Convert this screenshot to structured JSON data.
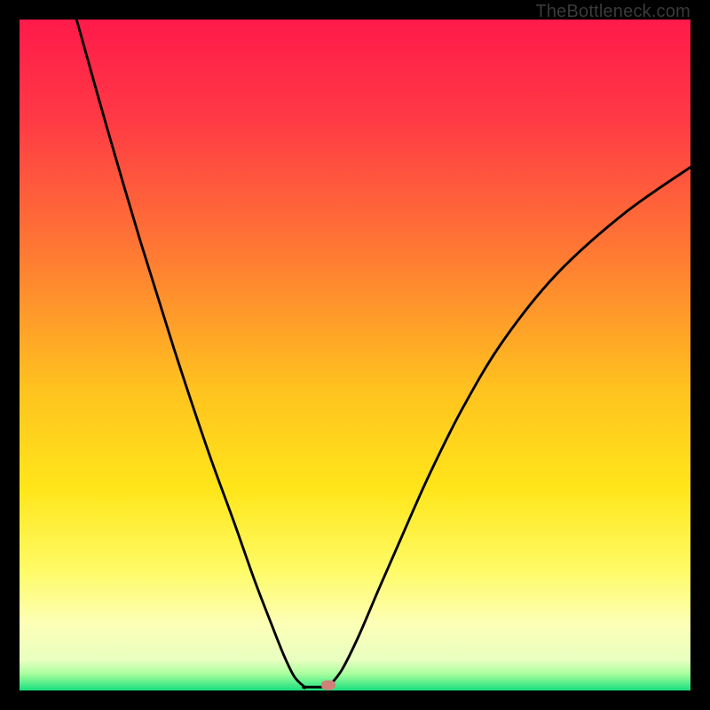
{
  "watermark": "TheBottleneck.com",
  "chart_data": {
    "type": "line",
    "title": "",
    "xlabel": "",
    "ylabel": "",
    "xlim": [
      0,
      100
    ],
    "ylim": [
      0,
      100
    ],
    "grid": false,
    "legend": false,
    "gradient_stops": [
      {
        "offset": 0.0,
        "color": "#ff1a4a"
      },
      {
        "offset": 0.15,
        "color": "#ff3a45"
      },
      {
        "offset": 0.35,
        "color": "#ff7a33"
      },
      {
        "offset": 0.55,
        "color": "#ffc21f"
      },
      {
        "offset": 0.7,
        "color": "#ffe61a"
      },
      {
        "offset": 0.82,
        "color": "#fffb66"
      },
      {
        "offset": 0.9,
        "color": "#fdffb6"
      },
      {
        "offset": 0.955,
        "color": "#e8ffc0"
      },
      {
        "offset": 0.975,
        "color": "#a9ff9e"
      },
      {
        "offset": 1.0,
        "color": "#18e07e"
      }
    ],
    "curve": {
      "left_branch": {
        "x": [
          8.5,
          13,
          18,
          23,
          28,
          32,
          35,
          37.5,
          39.5,
          41,
          42.5
        ],
        "y": [
          100,
          84,
          67,
          51,
          36,
          25,
          16.5,
          10,
          5,
          2,
          0.5
        ]
      },
      "flat_segment": {
        "x": [
          42.5,
          46
        ],
        "y": [
          0.5,
          0.5
        ]
      },
      "right_branch": {
        "x": [
          46,
          48,
          50.5,
          53.5,
          57,
          61,
          66,
          72,
          80,
          90,
          100
        ],
        "y": [
          0.5,
          3,
          8,
          15,
          23,
          32,
          42,
          52,
          62,
          71,
          78
        ]
      }
    },
    "marker": {
      "x": 46,
      "y": 0.8,
      "color": "#cf8077"
    }
  }
}
